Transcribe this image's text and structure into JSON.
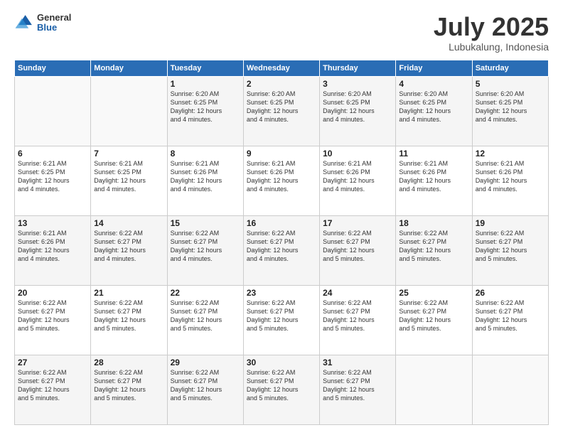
{
  "logo": {
    "general": "General",
    "blue": "Blue"
  },
  "header": {
    "month": "July 2025",
    "location": "Lubukalung, Indonesia"
  },
  "days_of_week": [
    "Sunday",
    "Monday",
    "Tuesday",
    "Wednesday",
    "Thursday",
    "Friday",
    "Saturday"
  ],
  "weeks": [
    [
      {
        "day": "",
        "info": ""
      },
      {
        "day": "",
        "info": ""
      },
      {
        "day": "1",
        "info": "Sunrise: 6:20 AM\nSunset: 6:25 PM\nDaylight: 12 hours\nand 4 minutes."
      },
      {
        "day": "2",
        "info": "Sunrise: 6:20 AM\nSunset: 6:25 PM\nDaylight: 12 hours\nand 4 minutes."
      },
      {
        "day": "3",
        "info": "Sunrise: 6:20 AM\nSunset: 6:25 PM\nDaylight: 12 hours\nand 4 minutes."
      },
      {
        "day": "4",
        "info": "Sunrise: 6:20 AM\nSunset: 6:25 PM\nDaylight: 12 hours\nand 4 minutes."
      },
      {
        "day": "5",
        "info": "Sunrise: 6:20 AM\nSunset: 6:25 PM\nDaylight: 12 hours\nand 4 minutes."
      }
    ],
    [
      {
        "day": "6",
        "info": "Sunrise: 6:21 AM\nSunset: 6:25 PM\nDaylight: 12 hours\nand 4 minutes."
      },
      {
        "day": "7",
        "info": "Sunrise: 6:21 AM\nSunset: 6:25 PM\nDaylight: 12 hours\nand 4 minutes."
      },
      {
        "day": "8",
        "info": "Sunrise: 6:21 AM\nSunset: 6:26 PM\nDaylight: 12 hours\nand 4 minutes."
      },
      {
        "day": "9",
        "info": "Sunrise: 6:21 AM\nSunset: 6:26 PM\nDaylight: 12 hours\nand 4 minutes."
      },
      {
        "day": "10",
        "info": "Sunrise: 6:21 AM\nSunset: 6:26 PM\nDaylight: 12 hours\nand 4 minutes."
      },
      {
        "day": "11",
        "info": "Sunrise: 6:21 AM\nSunset: 6:26 PM\nDaylight: 12 hours\nand 4 minutes."
      },
      {
        "day": "12",
        "info": "Sunrise: 6:21 AM\nSunset: 6:26 PM\nDaylight: 12 hours\nand 4 minutes."
      }
    ],
    [
      {
        "day": "13",
        "info": "Sunrise: 6:21 AM\nSunset: 6:26 PM\nDaylight: 12 hours\nand 4 minutes."
      },
      {
        "day": "14",
        "info": "Sunrise: 6:22 AM\nSunset: 6:27 PM\nDaylight: 12 hours\nand 4 minutes."
      },
      {
        "day": "15",
        "info": "Sunrise: 6:22 AM\nSunset: 6:27 PM\nDaylight: 12 hours\nand 4 minutes."
      },
      {
        "day": "16",
        "info": "Sunrise: 6:22 AM\nSunset: 6:27 PM\nDaylight: 12 hours\nand 4 minutes."
      },
      {
        "day": "17",
        "info": "Sunrise: 6:22 AM\nSunset: 6:27 PM\nDaylight: 12 hours\nand 5 minutes."
      },
      {
        "day": "18",
        "info": "Sunrise: 6:22 AM\nSunset: 6:27 PM\nDaylight: 12 hours\nand 5 minutes."
      },
      {
        "day": "19",
        "info": "Sunrise: 6:22 AM\nSunset: 6:27 PM\nDaylight: 12 hours\nand 5 minutes."
      }
    ],
    [
      {
        "day": "20",
        "info": "Sunrise: 6:22 AM\nSunset: 6:27 PM\nDaylight: 12 hours\nand 5 minutes."
      },
      {
        "day": "21",
        "info": "Sunrise: 6:22 AM\nSunset: 6:27 PM\nDaylight: 12 hours\nand 5 minutes."
      },
      {
        "day": "22",
        "info": "Sunrise: 6:22 AM\nSunset: 6:27 PM\nDaylight: 12 hours\nand 5 minutes."
      },
      {
        "day": "23",
        "info": "Sunrise: 6:22 AM\nSunset: 6:27 PM\nDaylight: 12 hours\nand 5 minutes."
      },
      {
        "day": "24",
        "info": "Sunrise: 6:22 AM\nSunset: 6:27 PM\nDaylight: 12 hours\nand 5 minutes."
      },
      {
        "day": "25",
        "info": "Sunrise: 6:22 AM\nSunset: 6:27 PM\nDaylight: 12 hours\nand 5 minutes."
      },
      {
        "day": "26",
        "info": "Sunrise: 6:22 AM\nSunset: 6:27 PM\nDaylight: 12 hours\nand 5 minutes."
      }
    ],
    [
      {
        "day": "27",
        "info": "Sunrise: 6:22 AM\nSunset: 6:27 PM\nDaylight: 12 hours\nand 5 minutes."
      },
      {
        "day": "28",
        "info": "Sunrise: 6:22 AM\nSunset: 6:27 PM\nDaylight: 12 hours\nand 5 minutes."
      },
      {
        "day": "29",
        "info": "Sunrise: 6:22 AM\nSunset: 6:27 PM\nDaylight: 12 hours\nand 5 minutes."
      },
      {
        "day": "30",
        "info": "Sunrise: 6:22 AM\nSunset: 6:27 PM\nDaylight: 12 hours\nand 5 minutes."
      },
      {
        "day": "31",
        "info": "Sunrise: 6:22 AM\nSunset: 6:27 PM\nDaylight: 12 hours\nand 5 minutes."
      },
      {
        "day": "",
        "info": ""
      },
      {
        "day": "",
        "info": ""
      }
    ]
  ]
}
